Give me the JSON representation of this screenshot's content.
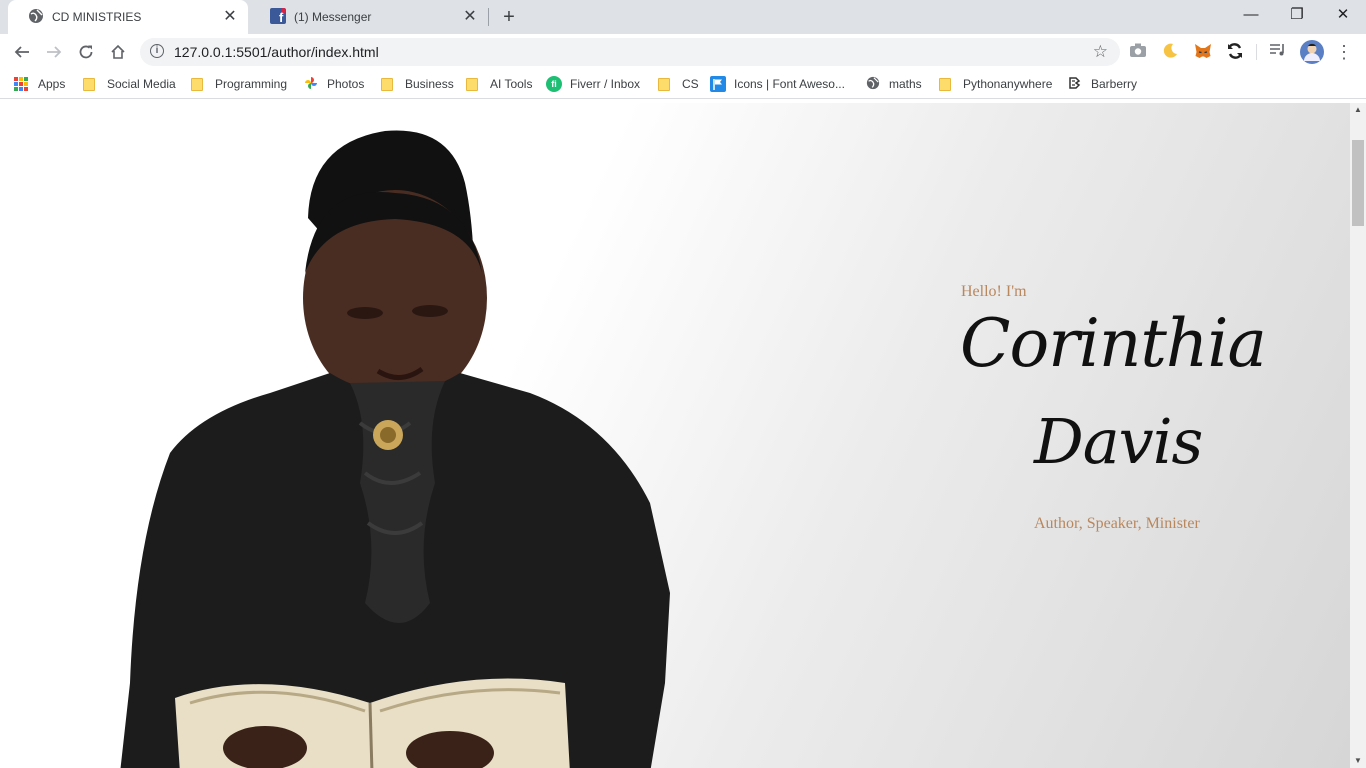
{
  "tabs": [
    {
      "title": "CD MINISTRIES",
      "icon": "globe-icon"
    },
    {
      "title": "(1) Messenger",
      "icon": "facebook-icon"
    }
  ],
  "address_bar": {
    "url": "127.0.0.1:5501/author/index.html"
  },
  "bookmarks": [
    {
      "label": "Apps",
      "icon": "apps-grid-icon"
    },
    {
      "label": "Social Media",
      "icon": "folder-icon"
    },
    {
      "label": "Programming",
      "icon": "folder-icon"
    },
    {
      "label": "Photos",
      "icon": "photos-pinwheel-icon"
    },
    {
      "label": "Business",
      "icon": "folder-icon"
    },
    {
      "label": "AI Tools",
      "icon": "folder-icon"
    },
    {
      "label": "Fiverr / Inbox",
      "icon": "fiverr-icon"
    },
    {
      "label": "CS",
      "icon": "folder-icon"
    },
    {
      "label": "Icons | Font Aweso...",
      "icon": "font-awesome-flag-icon"
    },
    {
      "label": "maths",
      "icon": "globe-icon"
    },
    {
      "label": "Pythonanywhere",
      "icon": "folder-icon"
    },
    {
      "label": "Barberry",
      "icon": "barberry-icon"
    }
  ],
  "hero": {
    "greeting": "Hello! I'm",
    "first_name": "Corinthia",
    "last_name": "Davis",
    "roles": "Author, Speaker, Minister"
  },
  "colors": {
    "accent": "#b9875e",
    "name": "#111111",
    "tab_strip": "#dee1e6"
  }
}
